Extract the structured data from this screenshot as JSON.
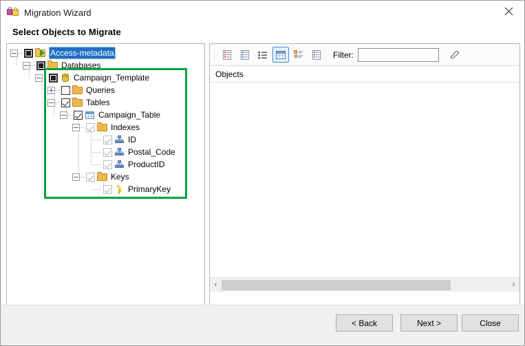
{
  "window": {
    "title": "Migration Wizard",
    "app_icon": "padlocks-icon",
    "close_label": "✕"
  },
  "header": {
    "subtitle": "Select Objects to Migrate"
  },
  "tree": {
    "nodes": [
      {
        "label": "Access-metadata",
        "icon": "folder-arrow-icon",
        "checkbox": "partial",
        "expander": "minus",
        "depth": 0,
        "selected": true
      },
      {
        "label": "Databases",
        "icon": "folder-icon",
        "checkbox": "partial",
        "expander": "minus",
        "depth": 1,
        "selected": false
      },
      {
        "label": "Campaign_Template",
        "icon": "database-icon",
        "checkbox": "partial",
        "expander": "minus",
        "depth": 2,
        "selected": false
      },
      {
        "label": "Queries",
        "icon": "folder-icon",
        "checkbox": "unchecked",
        "expander": "plus",
        "depth": 3,
        "selected": false
      },
      {
        "label": "Tables",
        "icon": "folder-icon",
        "checkbox": "checked",
        "expander": "minus",
        "depth": 3,
        "selected": false
      },
      {
        "label": "Campaign_Table",
        "icon": "table-grid-icon",
        "checkbox": "checked",
        "expander": "minus",
        "depth": 4,
        "selected": false
      },
      {
        "label": "Indexes",
        "icon": "folder-icon",
        "checkbox": "checked-dim",
        "expander": "minus",
        "depth": 5,
        "selected": false
      },
      {
        "label": "ID",
        "icon": "index-icon",
        "checkbox": "checked-dim",
        "expander": "none",
        "depth": 6,
        "selected": false
      },
      {
        "label": "Postal_Code",
        "icon": "index-icon",
        "checkbox": "checked-dim",
        "expander": "none",
        "depth": 6,
        "selected": false
      },
      {
        "label": "ProductID",
        "icon": "index-icon",
        "checkbox": "checked-dim",
        "expander": "none",
        "depth": 6,
        "selected": false
      },
      {
        "label": "Keys",
        "icon": "folder-icon",
        "checkbox": "checked-dim",
        "expander": "minus",
        "depth": 5,
        "selected": false
      },
      {
        "label": "PrimaryKey",
        "icon": "key-icon",
        "checkbox": "checked-dim",
        "expander": "none",
        "depth": 6,
        "selected": false
      }
    ]
  },
  "annotation": {
    "highlight_color": "#00a33e"
  },
  "objects_panel": {
    "toolbar": {
      "buttons": [
        {
          "name": "detail-red-view-icon",
          "active": false
        },
        {
          "name": "detail-blue-view-icon",
          "active": false
        },
        {
          "name": "list-view-icon",
          "active": false
        },
        {
          "name": "grid-view-icon",
          "active": true
        },
        {
          "name": "tree-view-icon",
          "active": false
        },
        {
          "name": "report-view-icon",
          "active": false
        }
      ],
      "filter_label": "Filter:",
      "filter_value": "",
      "filter_placeholder": "",
      "eraser_icon": "eraser-icon"
    },
    "column_header": "Objects",
    "rows": [],
    "scroll": {
      "left_arrow": "‹",
      "right_arrow": "›",
      "thumb_percent": 80
    }
  },
  "footer": {
    "back_label": "< Back",
    "next_label": "Next >",
    "close_label": "Close"
  }
}
